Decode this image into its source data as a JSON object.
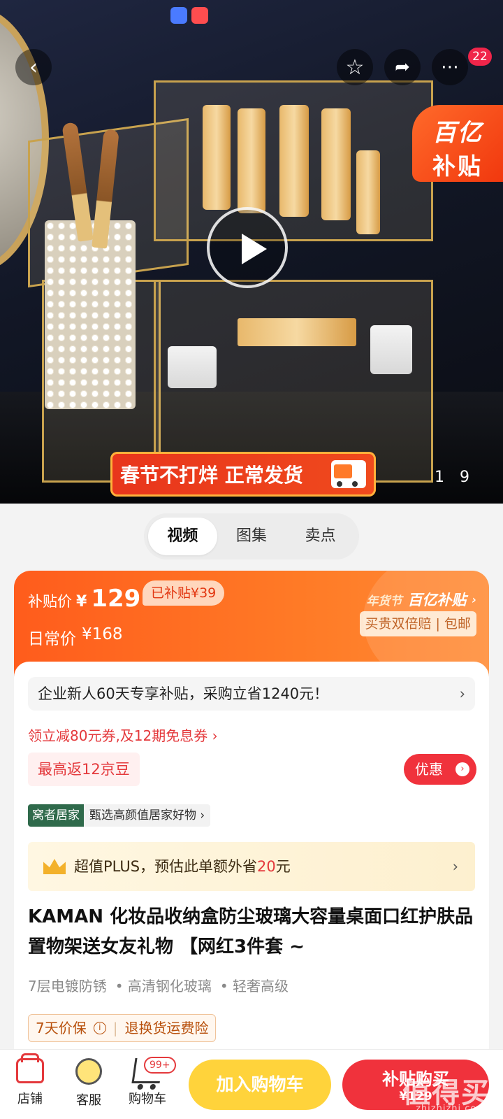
{
  "hero": {
    "subsidy_badge": {
      "line1": "百亿",
      "line2": "补贴"
    },
    "cart_badge": "22",
    "banner_text": "春节不打烊 正常发货",
    "pager": {
      "current": "1",
      "total": "9"
    }
  },
  "tabs": [
    "视频",
    "图集",
    "卖点"
  ],
  "price": {
    "subsidy_label": "补贴价",
    "currency": "¥",
    "subsidy_price": "129",
    "subsidized_tag": "已补贴¥39",
    "regular_label": "日常价",
    "regular_price": "¥168",
    "festival_tag": "年货节",
    "brand_tag": "百亿补贴",
    "guarantee": "买贵双倍赔 | 包邮"
  },
  "info": {
    "enterprise_offer": "企业新人60天专享补贴，采购立省1240元！",
    "coupon_link": "领立减80元券,及12期免息券 ›",
    "jd_beans": "最高返12京豆",
    "promo_button": "优惠",
    "store_name": "窝者居家",
    "store_slogan": "甄选高颜值居家好物 ›",
    "plus_prefix": "超值PLUS，预估此单额外省",
    "plus_amount": "20",
    "plus_suffix": "元",
    "title": "KAMAN 化妆品收纳盒防尘玻璃大容量桌面口红护肤品置物架送女友礼物 【网红3件套 ~",
    "features": [
      "7层电镀防锈",
      "• 高清钢化玻璃",
      "• 轻奢高级"
    ],
    "warranty_a": "7天价保",
    "warranty_b": "退换货运费险"
  },
  "bottom": {
    "shop": "店铺",
    "service": "客服",
    "cart": "购物车",
    "cart_count": "99+",
    "add_to_cart": "加入购物车",
    "buy_label": "补贴购买",
    "buy_price": "¥129"
  },
  "watermark": {
    "main": "值得买",
    "sub": "zhizhizhi.com"
  },
  "colors": {
    "accent_red": "#f0323c",
    "subsidy_orange": "#ff5c1c",
    "cart_yellow": "#ffd33b"
  }
}
